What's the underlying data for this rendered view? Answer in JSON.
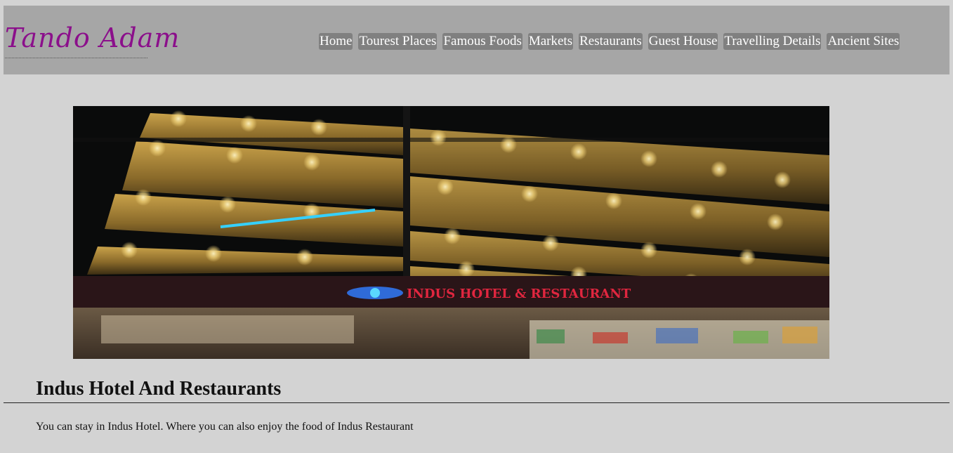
{
  "header": {
    "logo_text": "Tando Adam",
    "nav": [
      {
        "label": "Home"
      },
      {
        "label": "Tourest Places"
      },
      {
        "label": "Famous Foods"
      },
      {
        "label": "Markets"
      },
      {
        "label": "Restaurants"
      },
      {
        "label": "Guest House"
      },
      {
        "label": "Travelling Details"
      },
      {
        "label": "Ancient Sites"
      }
    ]
  },
  "main": {
    "image_sign_text": "INDUS HOTEL & RESTAURANT",
    "headline": "Indus Hotel And Restaurants",
    "paragraph": "You can stay in Indus Hotel. Where you can also enjoy the food of Indus Restaurant"
  },
  "colors": {
    "page_background": "#d3d3d3",
    "header_background": "#a6a6a6",
    "nav_button_background": "#808080",
    "logo_color": "#8b0f8b"
  }
}
